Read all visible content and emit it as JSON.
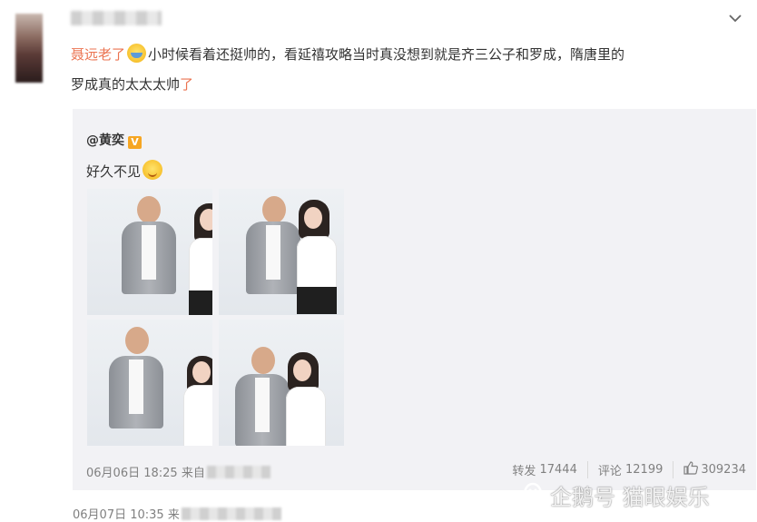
{
  "post": {
    "tag": "聂远老了",
    "text_1": "小时候看着还挺帅的，看延禧攻略当时真没想到就是齐三公子和罗成，隋唐里的",
    "text_2": "罗成真的太太太帅",
    "text_end": "了",
    "emoji_1": "laugh-emoji"
  },
  "repost": {
    "user": "@黄奕",
    "badge": "V",
    "text": "好久不见",
    "emoji": "smile-emoji",
    "photo_count": 4,
    "time": "06月06日 18:25",
    "source_prefix": "来自",
    "forward_label": "转发",
    "forward_count": "17444",
    "comment_label": "评论",
    "comment_count": "12199",
    "like_count": "309234"
  },
  "bottom": {
    "time": "06月07日 10:35",
    "source_prefix": "来"
  },
  "watermark": {
    "text": "企鹅号 猫眼娱乐"
  },
  "colors": {
    "tag": "#eb7350",
    "repost_bg": "#f2f2f5",
    "meta": "#808080",
    "badge": "#f6a623"
  }
}
